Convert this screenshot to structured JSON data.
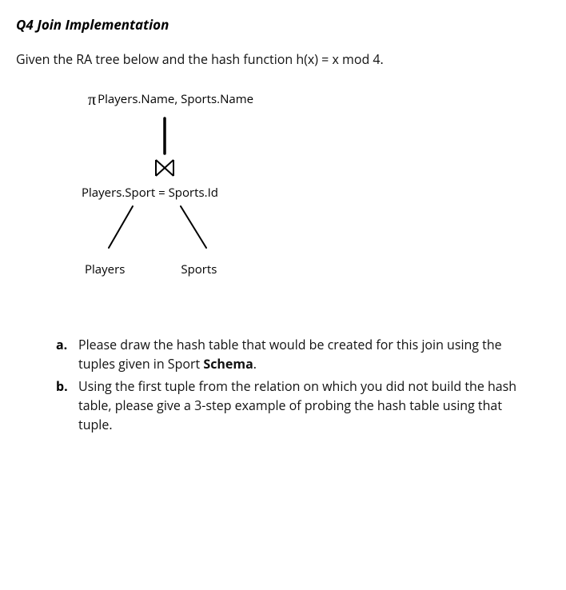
{
  "heading": "Q4 Join Implementation",
  "intro": "Given the RA tree below and the hash function h(x) = x mod 4.",
  "tree": {
    "pi_symbol": "π",
    "projection": "Players.Name, Sports.Name",
    "join_condition": "Players.Sport = Sports.Id",
    "left_leaf": "Players",
    "right_leaf": "Sports"
  },
  "questions": {
    "a": {
      "marker": "a.",
      "text_before": "Please draw the hash table that would be created for this join using the tuples given in Sport ",
      "bold": "Schema",
      "text_after": "."
    },
    "b": {
      "marker": "b.",
      "text": "Using the first tuple from the relation on which you did not build the hash table, please give a 3-step example of probing the hash table using that tuple."
    }
  }
}
